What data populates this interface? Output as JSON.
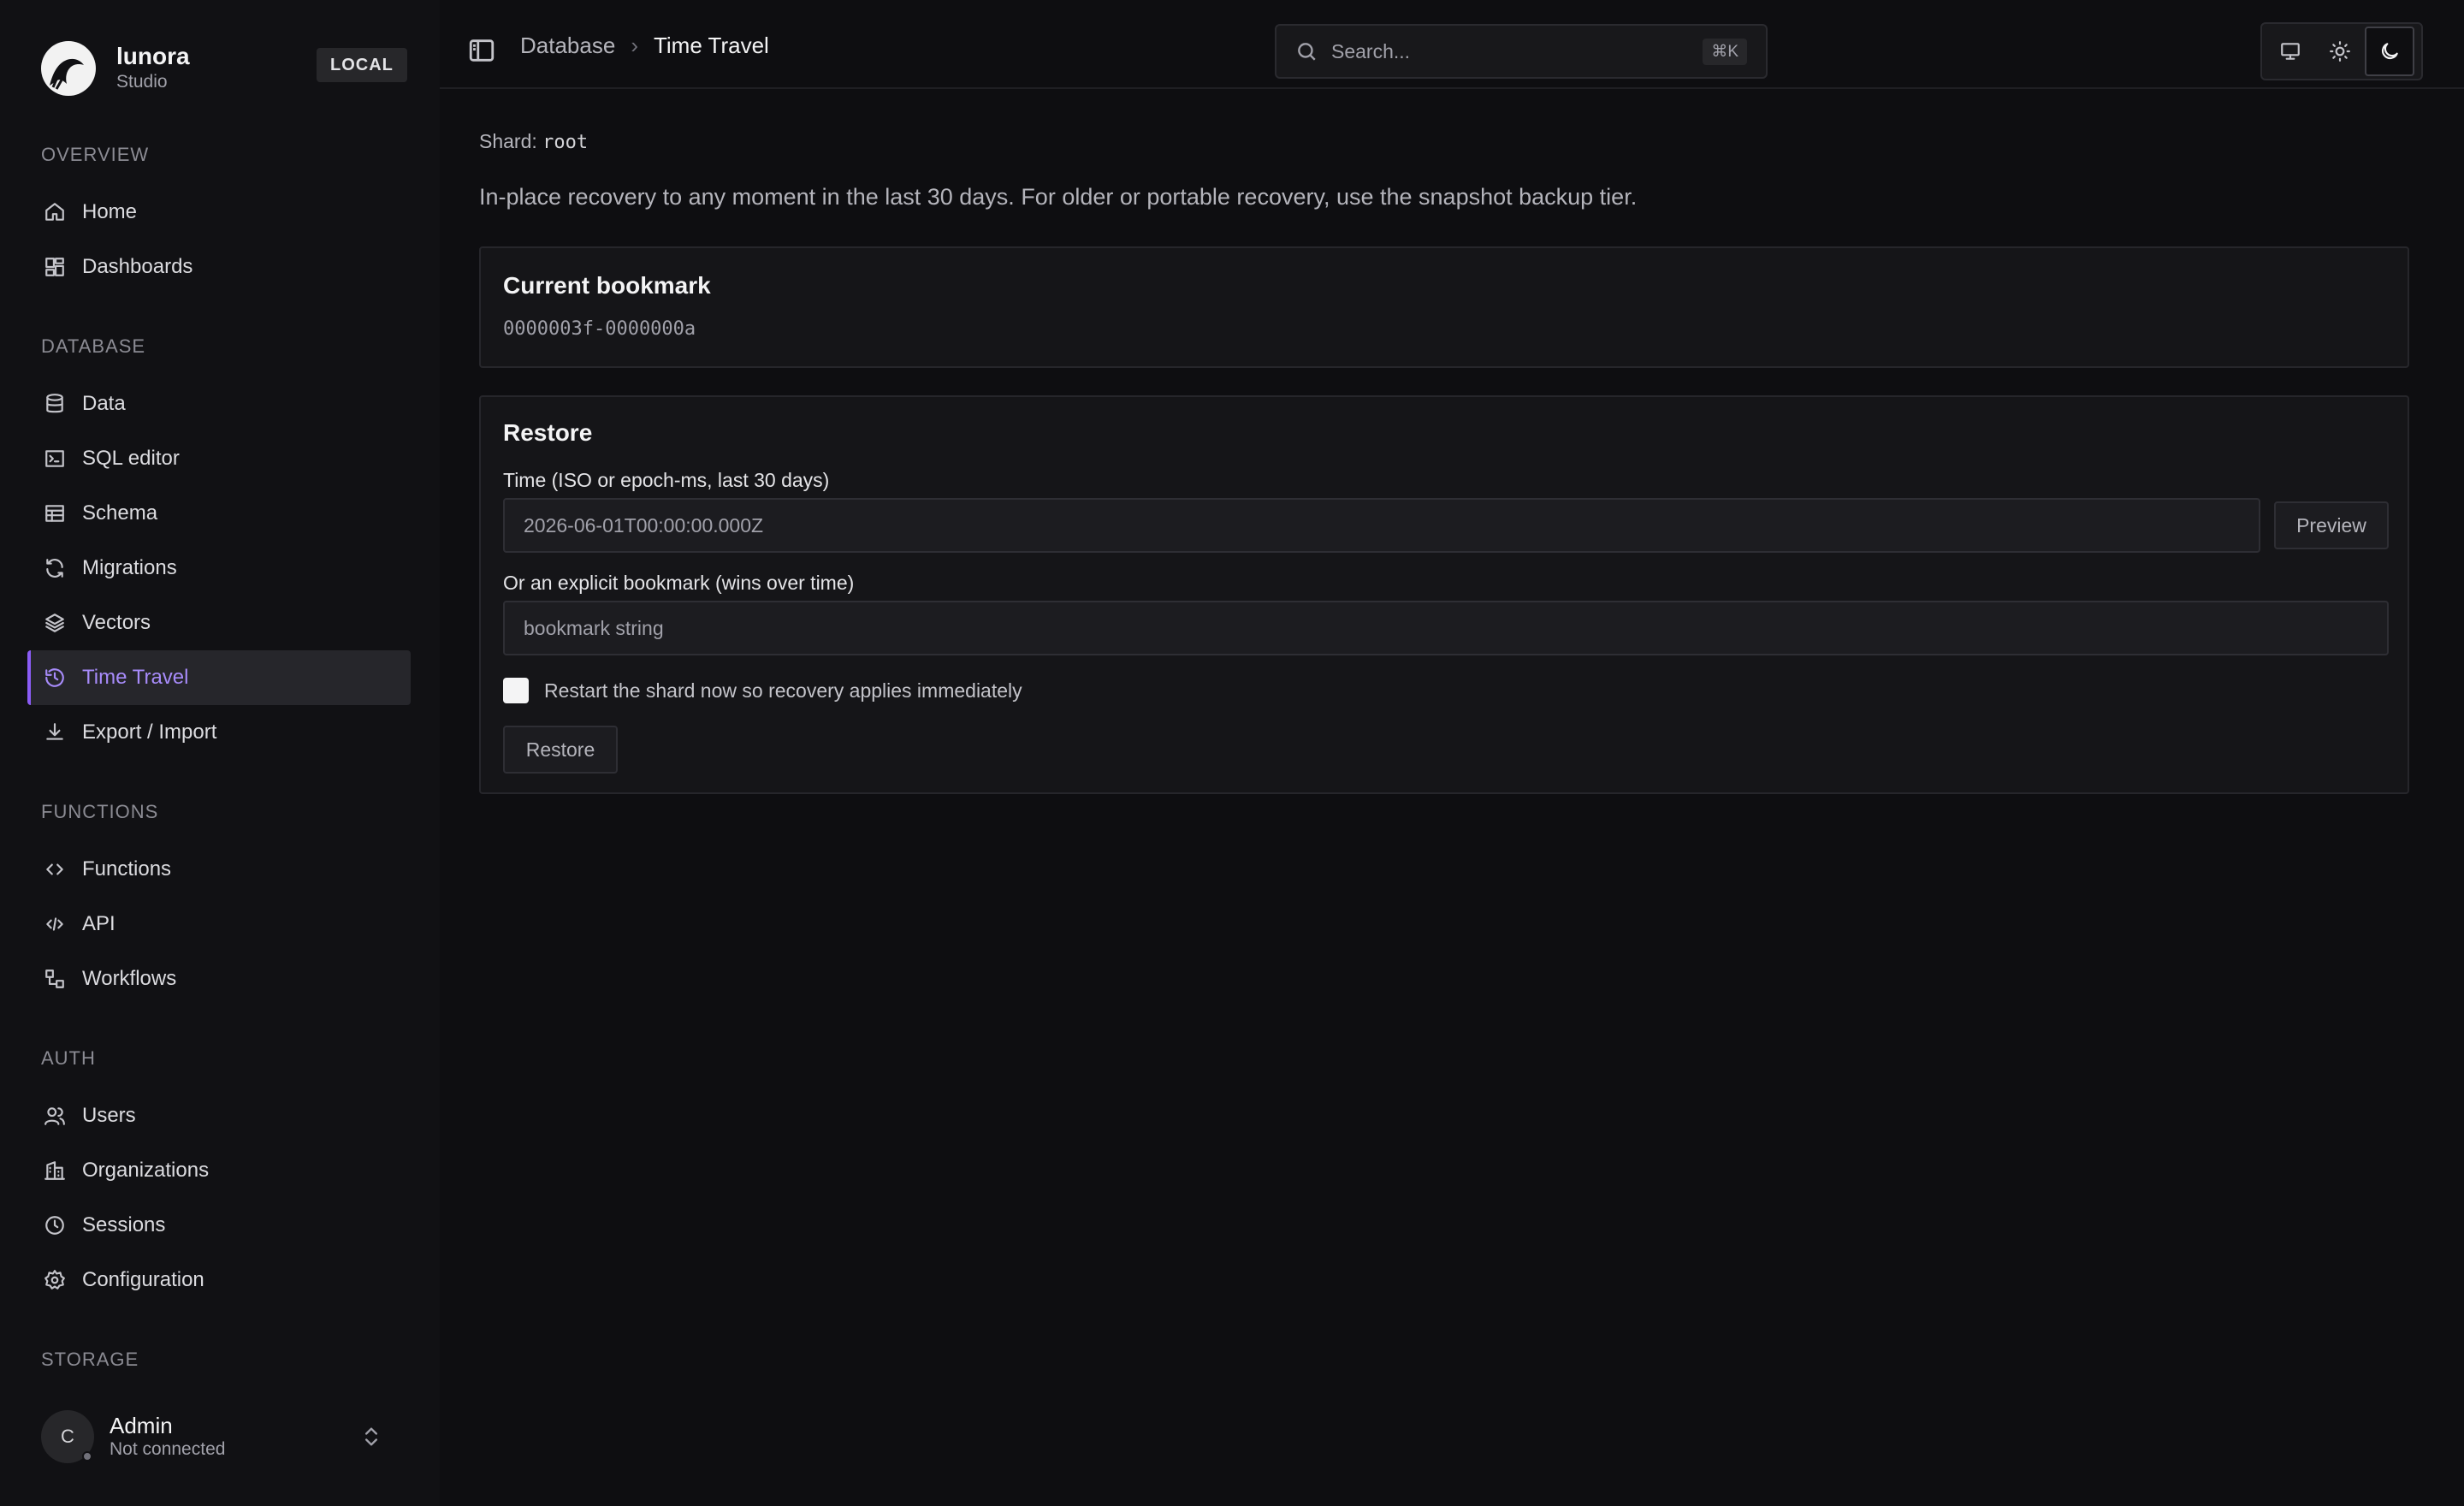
{
  "brand": {
    "name": "lunora",
    "subtitle": "Studio",
    "env_badge": "LOCAL"
  },
  "sidebar": {
    "sections": [
      {
        "title": "OVERVIEW",
        "items": [
          {
            "label": "Home",
            "icon": "home-icon"
          },
          {
            "label": "Dashboards",
            "icon": "dashboard-icon"
          }
        ]
      },
      {
        "title": "DATABASE",
        "items": [
          {
            "label": "Data",
            "icon": "database-icon"
          },
          {
            "label": "SQL editor",
            "icon": "terminal-icon"
          },
          {
            "label": "Schema",
            "icon": "table-icon"
          },
          {
            "label": "Migrations",
            "icon": "refresh-icon"
          },
          {
            "label": "Vectors",
            "icon": "layers-icon"
          },
          {
            "label": "Time Travel",
            "icon": "history-icon",
            "active": true
          },
          {
            "label": "Export / Import",
            "icon": "download-icon"
          }
        ]
      },
      {
        "title": "FUNCTIONS",
        "items": [
          {
            "label": "Functions",
            "icon": "code-icon"
          },
          {
            "label": "API",
            "icon": "code-xml-icon"
          },
          {
            "label": "Workflows",
            "icon": "workflow-icon"
          }
        ]
      },
      {
        "title": "AUTH",
        "items": [
          {
            "label": "Users",
            "icon": "users-icon"
          },
          {
            "label": "Organizations",
            "icon": "building-icon"
          },
          {
            "label": "Sessions",
            "icon": "clock-icon"
          },
          {
            "label": "Configuration",
            "icon": "gear-icon"
          }
        ]
      },
      {
        "title": "STORAGE",
        "items": []
      }
    ]
  },
  "user": {
    "initial": "C",
    "name": "Admin",
    "status": "Not connected"
  },
  "header": {
    "breadcrumb_parent": "Database",
    "breadcrumb_current": "Time Travel",
    "search_placeholder": "Search...",
    "search_shortcut": "⌘K"
  },
  "page": {
    "shard_label": "Shard:",
    "shard_value": "root",
    "intro": "In-place recovery to any moment in the last 30 days. For older or portable recovery, use the snapshot backup tier.",
    "bookmark_card": {
      "title": "Current bookmark",
      "value": "0000003f-0000000a"
    },
    "restore_card": {
      "title": "Restore",
      "time_label": "Time (ISO or epoch-ms, last 30 days)",
      "time_value": "2026-06-01T00:00:00.000Z",
      "preview_button": "Preview",
      "bookmark_label": "Or an explicit bookmark (wins over time)",
      "bookmark_placeholder": "bookmark string",
      "restart_label": "Restart the shard now so recovery applies immediately",
      "restore_button": "Restore"
    }
  },
  "colors": {
    "accent": "#a78bfa",
    "background": "#0e0e11",
    "sidebar": "#111114",
    "card": "#151518"
  }
}
